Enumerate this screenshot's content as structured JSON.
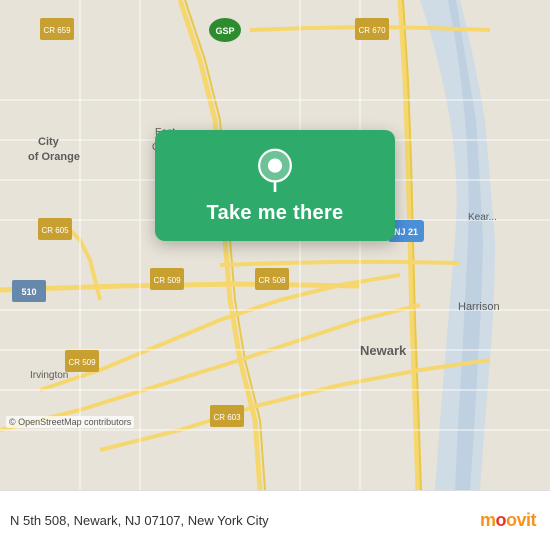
{
  "map": {
    "background_color": "#e8e0d5",
    "attribution": "© OpenStreetMap contributors"
  },
  "action_card": {
    "button_label": "Take me there",
    "pin_icon": "location-pin"
  },
  "bottom_bar": {
    "address": "N 5th 508, Newark, NJ 07107, New York City"
  },
  "branding": {
    "name": "moovit",
    "dot": "·"
  }
}
